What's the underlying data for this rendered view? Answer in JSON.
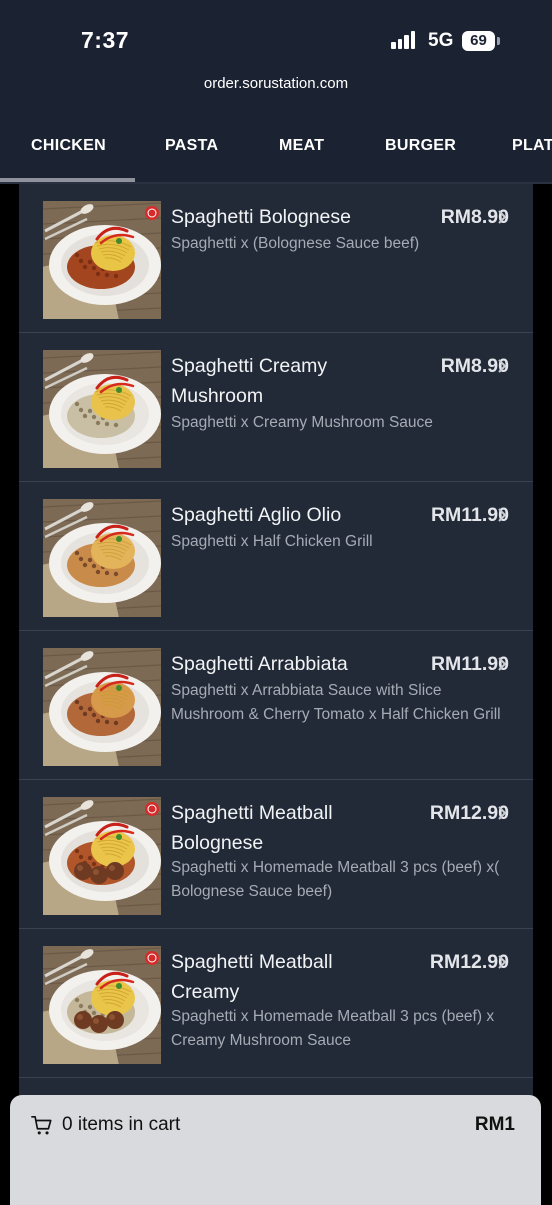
{
  "status_bar": {
    "time": "7:37",
    "network": "5G",
    "battery": "69"
  },
  "browser": {
    "url": "order.sorustation.com"
  },
  "tabs": [
    {
      "label": "CHICKEN",
      "active": true
    },
    {
      "label": "PASTA",
      "active": false
    },
    {
      "label": "MEAT",
      "active": false
    },
    {
      "label": "BURGER",
      "active": false
    },
    {
      "label": "PLAT",
      "active": false
    }
  ],
  "menu_items": [
    {
      "name": "Spaghetti Bolognese",
      "price": "RM8.90",
      "description": "Spaghetti x (Bolognese Sauce beef)",
      "sauce": "bolognese",
      "badge": true
    },
    {
      "name": "Spaghetti Creamy Mushroom",
      "price": "RM8.90",
      "description": "Spaghetti x Creamy Mushroom Sauce",
      "sauce": "creamy",
      "badge": false
    },
    {
      "name": "Spaghetti Aglio Olio",
      "price": "RM11.90",
      "description": "Spaghetti x Half Chicken Grill",
      "sauce": "aglio",
      "badge": false
    },
    {
      "name": "Spaghetti Arrabbiata",
      "price": "RM11.90",
      "description": "Spaghetti x Arrabbiata Sauce with Slice Mushroom & Cherry Tomato x Half Chicken Grill",
      "sauce": "arrabbiata",
      "badge": false
    },
    {
      "name": "Spaghetti Meatball Bolognese",
      "price": "RM12.90",
      "description": "Spaghetti x Homemade Meatball 3 pcs (beef) x( Bolognese Sauce beef)",
      "sauce": "meatball-bolognese",
      "badge": true
    },
    {
      "name": "Spaghetti Meatball Creamy",
      "price": "RM12.90",
      "description": "Spaghetti x Homemade Meatball 3 pcs (beef) x Creamy Mushroom Sauce",
      "sauce": "meatball-creamy",
      "badge": true
    }
  ],
  "cart": {
    "summary": "0 items in cart",
    "total": "RM1",
    "icon": "cart-icon"
  },
  "colors": {
    "header_bg": "#1b2231",
    "list_bg": "#222a38",
    "cart_bg": "#d8dadd",
    "badge_red": "#d62b2b"
  }
}
